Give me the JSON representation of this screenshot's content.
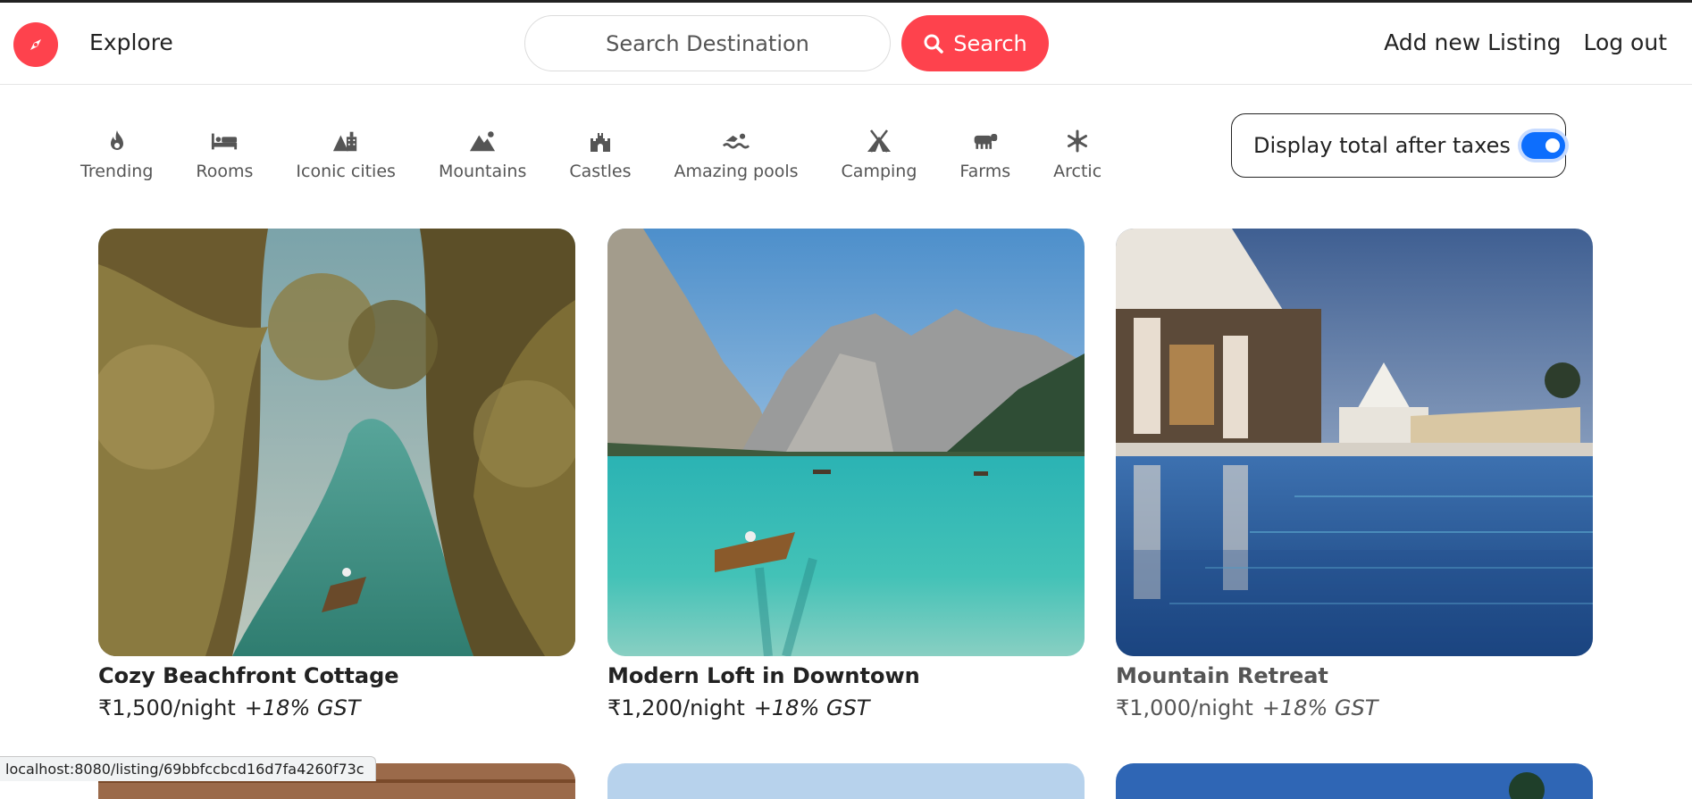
{
  "colors": {
    "brand": "#fe424d",
    "toggle_accent": "#0d6efd"
  },
  "navbar": {
    "logo_icon": "compass-icon",
    "explore_label": "Explore",
    "search": {
      "placeholder": "Search Destination",
      "value": "",
      "button_label": "Search",
      "button_icon": "search-icon"
    },
    "right_links": [
      {
        "label": "Add new Listing"
      },
      {
        "label": "Log out"
      }
    ]
  },
  "filters": [
    {
      "label": "Trending",
      "icon": "fire-icon"
    },
    {
      "label": "Rooms",
      "icon": "bed-icon"
    },
    {
      "label": "Iconic cities",
      "icon": "city-icon"
    },
    {
      "label": "Mountains",
      "icon": "mountain-icon"
    },
    {
      "label": "Castles",
      "icon": "castle-icon"
    },
    {
      "label": "Amazing pools",
      "icon": "swimmer-icon"
    },
    {
      "label": "Camping",
      "icon": "tent-icon"
    },
    {
      "label": "Farms",
      "icon": "cow-icon"
    },
    {
      "label": "Arctic",
      "icon": "snowflake-icon"
    }
  ],
  "tax_toggle": {
    "label": "Display total after taxes",
    "checked": true
  },
  "listings": [
    {
      "title": "Cozy Beachfront Cottage",
      "price": "₹1,500/night",
      "tax_note": "+18% GST"
    },
    {
      "title": "Modern Loft in Downtown",
      "price": "₹1,200/night",
      "tax_note": "+18% GST"
    },
    {
      "title": "Mountain Retreat",
      "price": "₹1,000/night",
      "tax_note": "+18% GST"
    }
  ],
  "status_bar": {
    "url": "localhost:8080/listing/69bbfccbcd16d7fa4260f73c"
  }
}
